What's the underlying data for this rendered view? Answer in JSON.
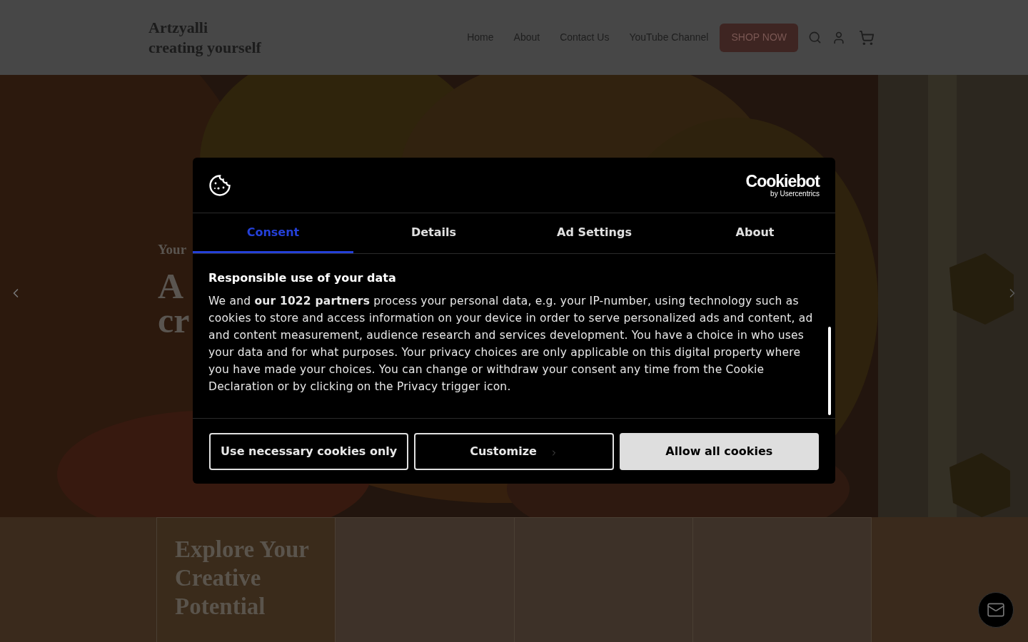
{
  "header": {
    "brand_line_1": "Artzyalli",
    "brand_line_2": "creating yourself",
    "nav": [
      {
        "label": "Home"
      },
      {
        "label": "About"
      },
      {
        "label": "Contact Us"
      },
      {
        "label": "YouTube Channel"
      }
    ],
    "shop_button": "SHOP NOW"
  },
  "hero": {
    "kind": "picture",
    "eyebrow": "Your",
    "title_line_1": "A",
    "title_line_2": "cr"
  },
  "cookie_dialog": {
    "brand": "Cookiebot",
    "brand_sub": "by Usercentrics",
    "tabs": [
      {
        "label": "Consent",
        "selected": true
      },
      {
        "label": "Details",
        "selected": false
      },
      {
        "label": "Ad Settings",
        "selected": false
      },
      {
        "label": "About",
        "selected": false
      }
    ],
    "heading": "Responsible use of your data",
    "body": "We and **our 1022 partners** process your personal data, e.g. your IP-number, using technology such as cookies to store and access information on your device in order to serve personalized ads and content, ad and content measurement, audience research and services development. You have a choice in who uses your data and for what purposes. Your privacy choices are only applicable on this digital property where you have made your choices. You can change or withdraw your consent any time from the Cookie Declaration or by clicking on the Privacy trigger icon.",
    "buttons": [
      {
        "label": "Use necessary cookies only",
        "kind": "outline"
      },
      {
        "label": "Customize",
        "kind": "chevron"
      },
      {
        "label": "Allow all cookies",
        "kind": "filled"
      }
    ]
  },
  "explore": {
    "heading": "Explore Your Creative Potential"
  }
}
